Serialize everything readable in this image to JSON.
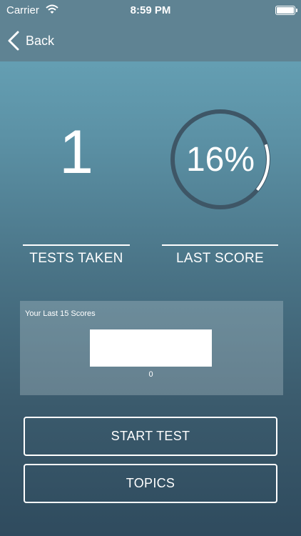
{
  "status_bar": {
    "carrier": "Carrier",
    "time": "8:59 PM"
  },
  "nav": {
    "back_label": "Back"
  },
  "stats": {
    "tests_taken_value": "1",
    "tests_taken_label": "TESTS TAKEN",
    "last_score_text": "16%",
    "last_score_fraction": 0.16,
    "last_score_label": "LAST SCORE"
  },
  "scores_panel": {
    "title": "Your Last 15 Scores",
    "bars": [
      {
        "label": "0"
      }
    ]
  },
  "buttons": {
    "start_test": "START TEST",
    "topics": "TOPICS"
  },
  "colors": {
    "ring_track": "#3e5666",
    "ring_progress": "#ffffff",
    "nav_bg": "#5f8393"
  }
}
